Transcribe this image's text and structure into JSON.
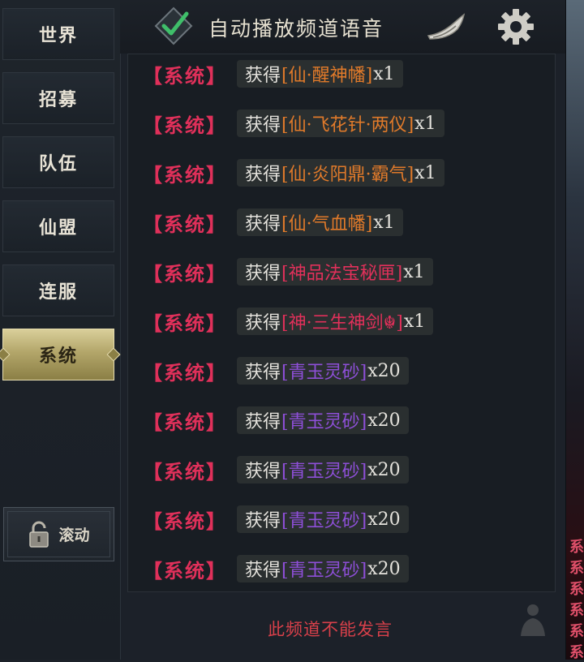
{
  "tabs": [
    {
      "label": "世界"
    },
    {
      "label": "招募"
    },
    {
      "label": "队伍"
    },
    {
      "label": "仙盟"
    },
    {
      "label": "连服"
    },
    {
      "label": "系统"
    }
  ],
  "scroll_button": {
    "label": "滚动"
  },
  "header": {
    "title": "自动播放频道语音"
  },
  "messages": [
    {
      "tag": "【系统】",
      "prefix": "获得",
      "item": "[仙·醒神幡]",
      "qty": "x1",
      "color": "#e07a2a"
    },
    {
      "tag": "【系统】",
      "prefix": "获得",
      "item": "[仙·飞花针·两仪]",
      "qty": "x1",
      "color": "#e07a2a"
    },
    {
      "tag": "【系统】",
      "prefix": "获得",
      "item": "[仙·炎阳鼎·霸气]",
      "qty": "x1",
      "color": "#e07a2a"
    },
    {
      "tag": "【系统】",
      "prefix": "获得",
      "item": "[仙·气血幡]",
      "qty": "x1",
      "color": "#e07a2a"
    },
    {
      "tag": "【系统】",
      "prefix": "获得",
      "item": "[神品法宝秘匣]",
      "qty": "x1",
      "color": "#e0305a"
    },
    {
      "tag": "【系统】",
      "prefix": "获得",
      "item": "[神·三生神剑☬]",
      "qty": "x1",
      "color": "#e0305a"
    },
    {
      "tag": "【系统】",
      "prefix": "获得",
      "item": "[青玉灵砂]",
      "qty": "x20",
      "color": "#8e4fd8"
    },
    {
      "tag": "【系统】",
      "prefix": "获得",
      "item": "[青玉灵砂]",
      "qty": "x20",
      "color": "#8e4fd8"
    },
    {
      "tag": "【系统】",
      "prefix": "获得",
      "item": "[青玉灵砂]",
      "qty": "x20",
      "color": "#8e4fd8"
    },
    {
      "tag": "【系统】",
      "prefix": "获得",
      "item": "[青玉灵砂]",
      "qty": "x20",
      "color": "#8e4fd8"
    },
    {
      "tag": "【系统】",
      "prefix": "获得",
      "item": "[青玉灵砂]",
      "qty": "x20",
      "color": "#8e4fd8"
    }
  ],
  "footer": {
    "note": "此频道不能发言"
  },
  "right_strip": {
    "glyph": "系"
  }
}
